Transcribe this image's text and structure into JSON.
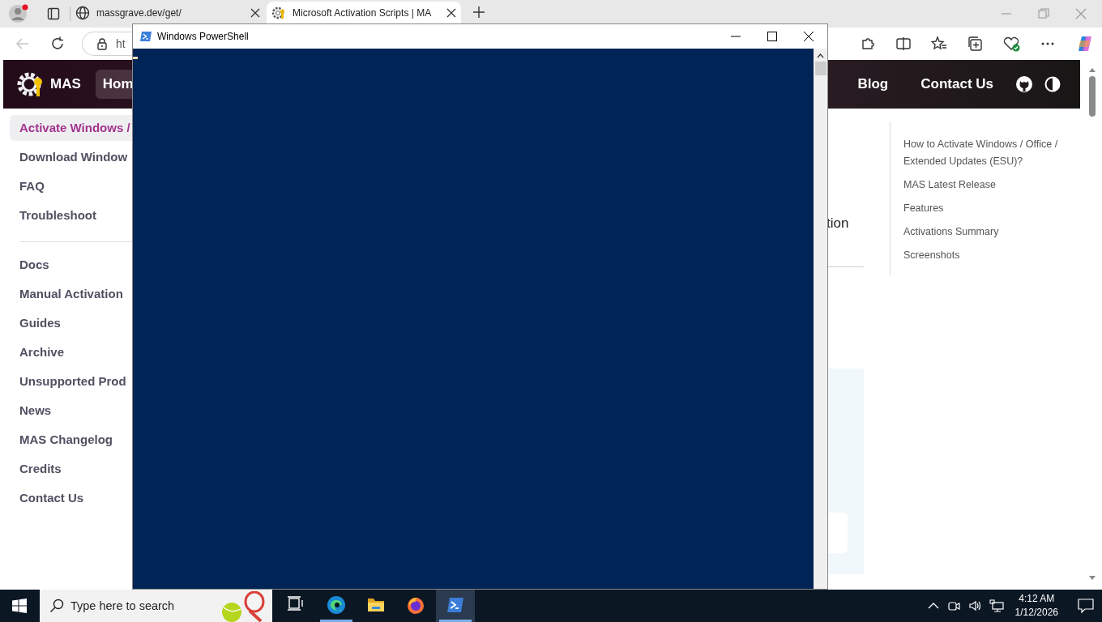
{
  "browser": {
    "tabs": [
      {
        "title": "massgrave.dev/get/",
        "selected": false
      },
      {
        "title": "Microsoft Activation Scripts | MA",
        "selected": true
      }
    ],
    "address": "ht"
  },
  "site": {
    "logo": "MAS",
    "nav": [
      {
        "label": "Hom",
        "selected": true
      },
      {
        "label": "Blog",
        "selected": false
      },
      {
        "label": "Contact Us",
        "selected": false
      }
    ],
    "sidebar_groups": [
      {
        "items": [
          {
            "label": "Activate Windows /",
            "selected": true
          },
          {
            "label": "Download Window",
            "selected": false
          },
          {
            "label": "FAQ",
            "selected": false
          },
          {
            "label": "Troubleshoot",
            "selected": false
          }
        ]
      },
      {
        "items": [
          {
            "label": "Docs",
            "selected": false
          },
          {
            "label": "Manual Activation",
            "selected": false
          },
          {
            "label": "Guides",
            "selected": false
          },
          {
            "label": "Archive",
            "selected": false
          },
          {
            "label": "Unsupported Prod",
            "selected": false
          },
          {
            "label": "News",
            "selected": false
          },
          {
            "label": "MAS Changelog",
            "selected": false
          },
          {
            "label": "Credits",
            "selected": false
          },
          {
            "label": "Contact Us",
            "selected": false
          }
        ]
      }
    ],
    "heading_fragment": "tion",
    "toc": [
      "How to Activate Windows / Office / Extended Updates (ESU)?",
      "MAS Latest Release",
      "Features",
      "Activations Summary",
      "Screenshots"
    ]
  },
  "powershell": {
    "title": "Windows PowerShell"
  },
  "taskbar": {
    "search_placeholder": "Type here to search",
    "apps": [
      {
        "kind": "task-view",
        "running": false,
        "active": false
      },
      {
        "kind": "edge",
        "running": true,
        "active": false
      },
      {
        "kind": "explorer",
        "running": false,
        "active": false
      },
      {
        "kind": "firefox",
        "running": false,
        "active": false
      },
      {
        "kind": "powershell",
        "running": true,
        "active": true
      }
    ],
    "time": "4:12 AM",
    "date": "1/12/2026"
  }
}
